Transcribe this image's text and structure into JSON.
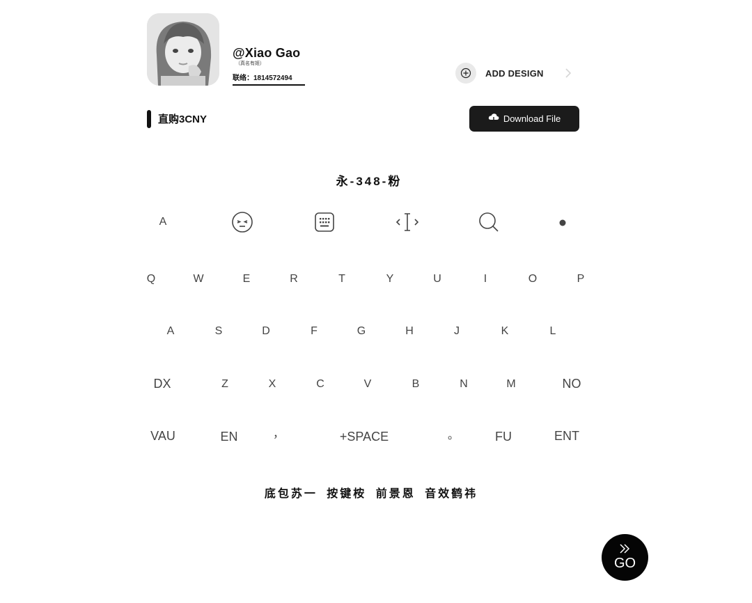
{
  "profile": {
    "handle": "@Xiao  Gao",
    "subnote": "（真名有姬）",
    "contact": "联络：1814572494"
  },
  "actions": {
    "add_design_label": "ADD DESIGN",
    "download_label": "Download File"
  },
  "price": {
    "label": "直购3CNY"
  },
  "code_title": "永-348-粉",
  "toolbar": {
    "letter_key": "A",
    "tools": [
      "emoji-icon",
      "keyboard-icon",
      "cursor-icon",
      "search-icon",
      "dot-icon"
    ]
  },
  "keyboard": {
    "row1": [
      "Q",
      "W",
      "E",
      "R",
      "T",
      "Y",
      "U",
      "I",
      "O",
      "P"
    ],
    "row2": [
      "A",
      "S",
      "D",
      "F",
      "G",
      "H",
      "J",
      "K",
      "L"
    ],
    "row3": [
      "DX",
      "Z",
      "X",
      "C",
      "V",
      "B",
      "N",
      "M",
      "NO"
    ],
    "row4": [
      "VAU",
      "EN",
      "，",
      "+SPACE",
      "。",
      "FU",
      "ENT"
    ]
  },
  "footer_text": "底包苏一 按键桉 前景恩 音效鹤祎",
  "go": {
    "label": "GO"
  },
  "colors": {
    "background": "#ffffff",
    "dark_button": "#1b1b1b",
    "key_text": "#444444"
  }
}
